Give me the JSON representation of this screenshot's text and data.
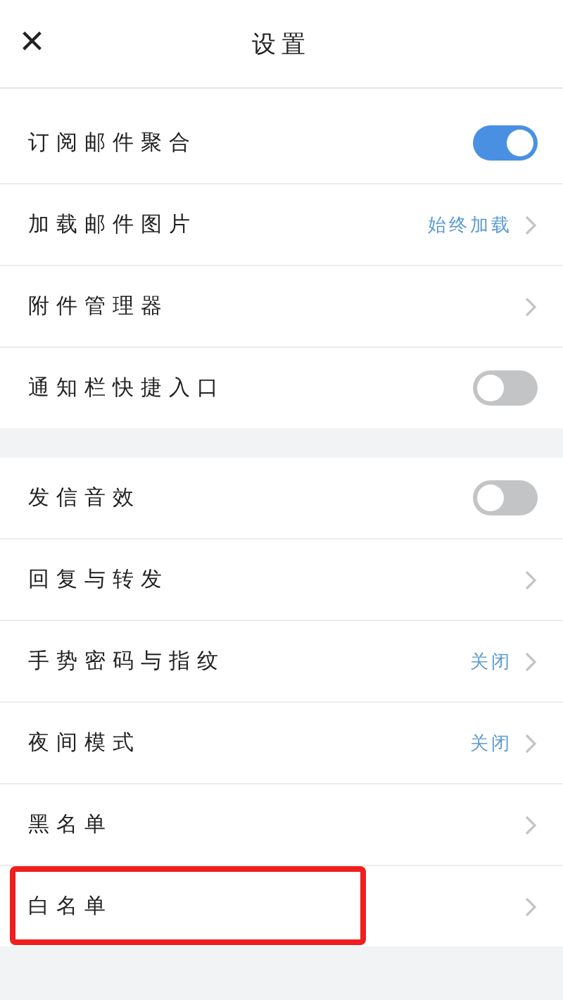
{
  "header": {
    "close_icon": "×",
    "title": "设置"
  },
  "groups": [
    {
      "rows": [
        {
          "kind": "toggle",
          "label": "订阅邮件聚合",
          "on": true
        },
        {
          "kind": "value",
          "label": "加载邮件图片",
          "value": "始终加载"
        },
        {
          "kind": "link",
          "label": "附件管理器"
        },
        {
          "kind": "toggle",
          "label": "通知栏快捷入口",
          "on": false
        }
      ]
    },
    {
      "rows": [
        {
          "kind": "toggle",
          "label": "发信音效",
          "on": false
        },
        {
          "kind": "link",
          "label": "回复与转发"
        },
        {
          "kind": "value",
          "label": "手势密码与指纹",
          "value": "关闭"
        },
        {
          "kind": "value",
          "label": "夜间模式",
          "value": "关闭"
        },
        {
          "kind": "link",
          "label": "黑名单"
        },
        {
          "kind": "link",
          "label": "白名单",
          "highlighted": true
        }
      ]
    }
  ]
}
